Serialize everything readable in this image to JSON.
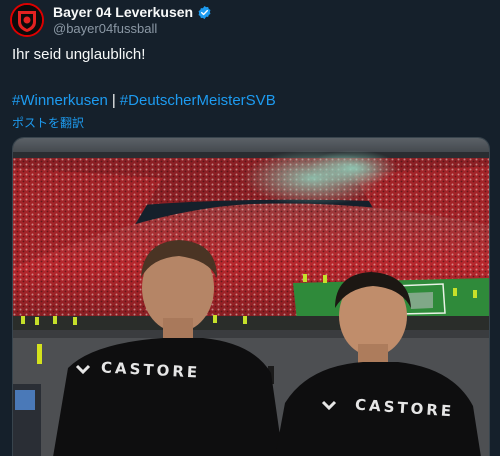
{
  "header": {
    "display_name": "Bayer 04 Leverkusen",
    "handle": "@bayer04fussball",
    "avatar_icon": "bayer04-crest-icon",
    "verified_icon": "verified-badge-icon"
  },
  "tweet": {
    "text": "Ihr seid unglaublich!",
    "hashtags": [
      "#Winnerkusen",
      "#DeutscherMeisterSVB"
    ],
    "separator": "|",
    "translate_label": "ポストを翻訳"
  },
  "media": {
    "shirt_left_text": "CASTORE",
    "shirt_right_text": "CASTORE"
  },
  "colors": {
    "background": "#15202b",
    "link": "#1d9bf0",
    "text": "#f7f9f9",
    "muted": "#8b98a5",
    "crowd_red": "#b8262c",
    "pitch_green": "#2f8a3a"
  }
}
